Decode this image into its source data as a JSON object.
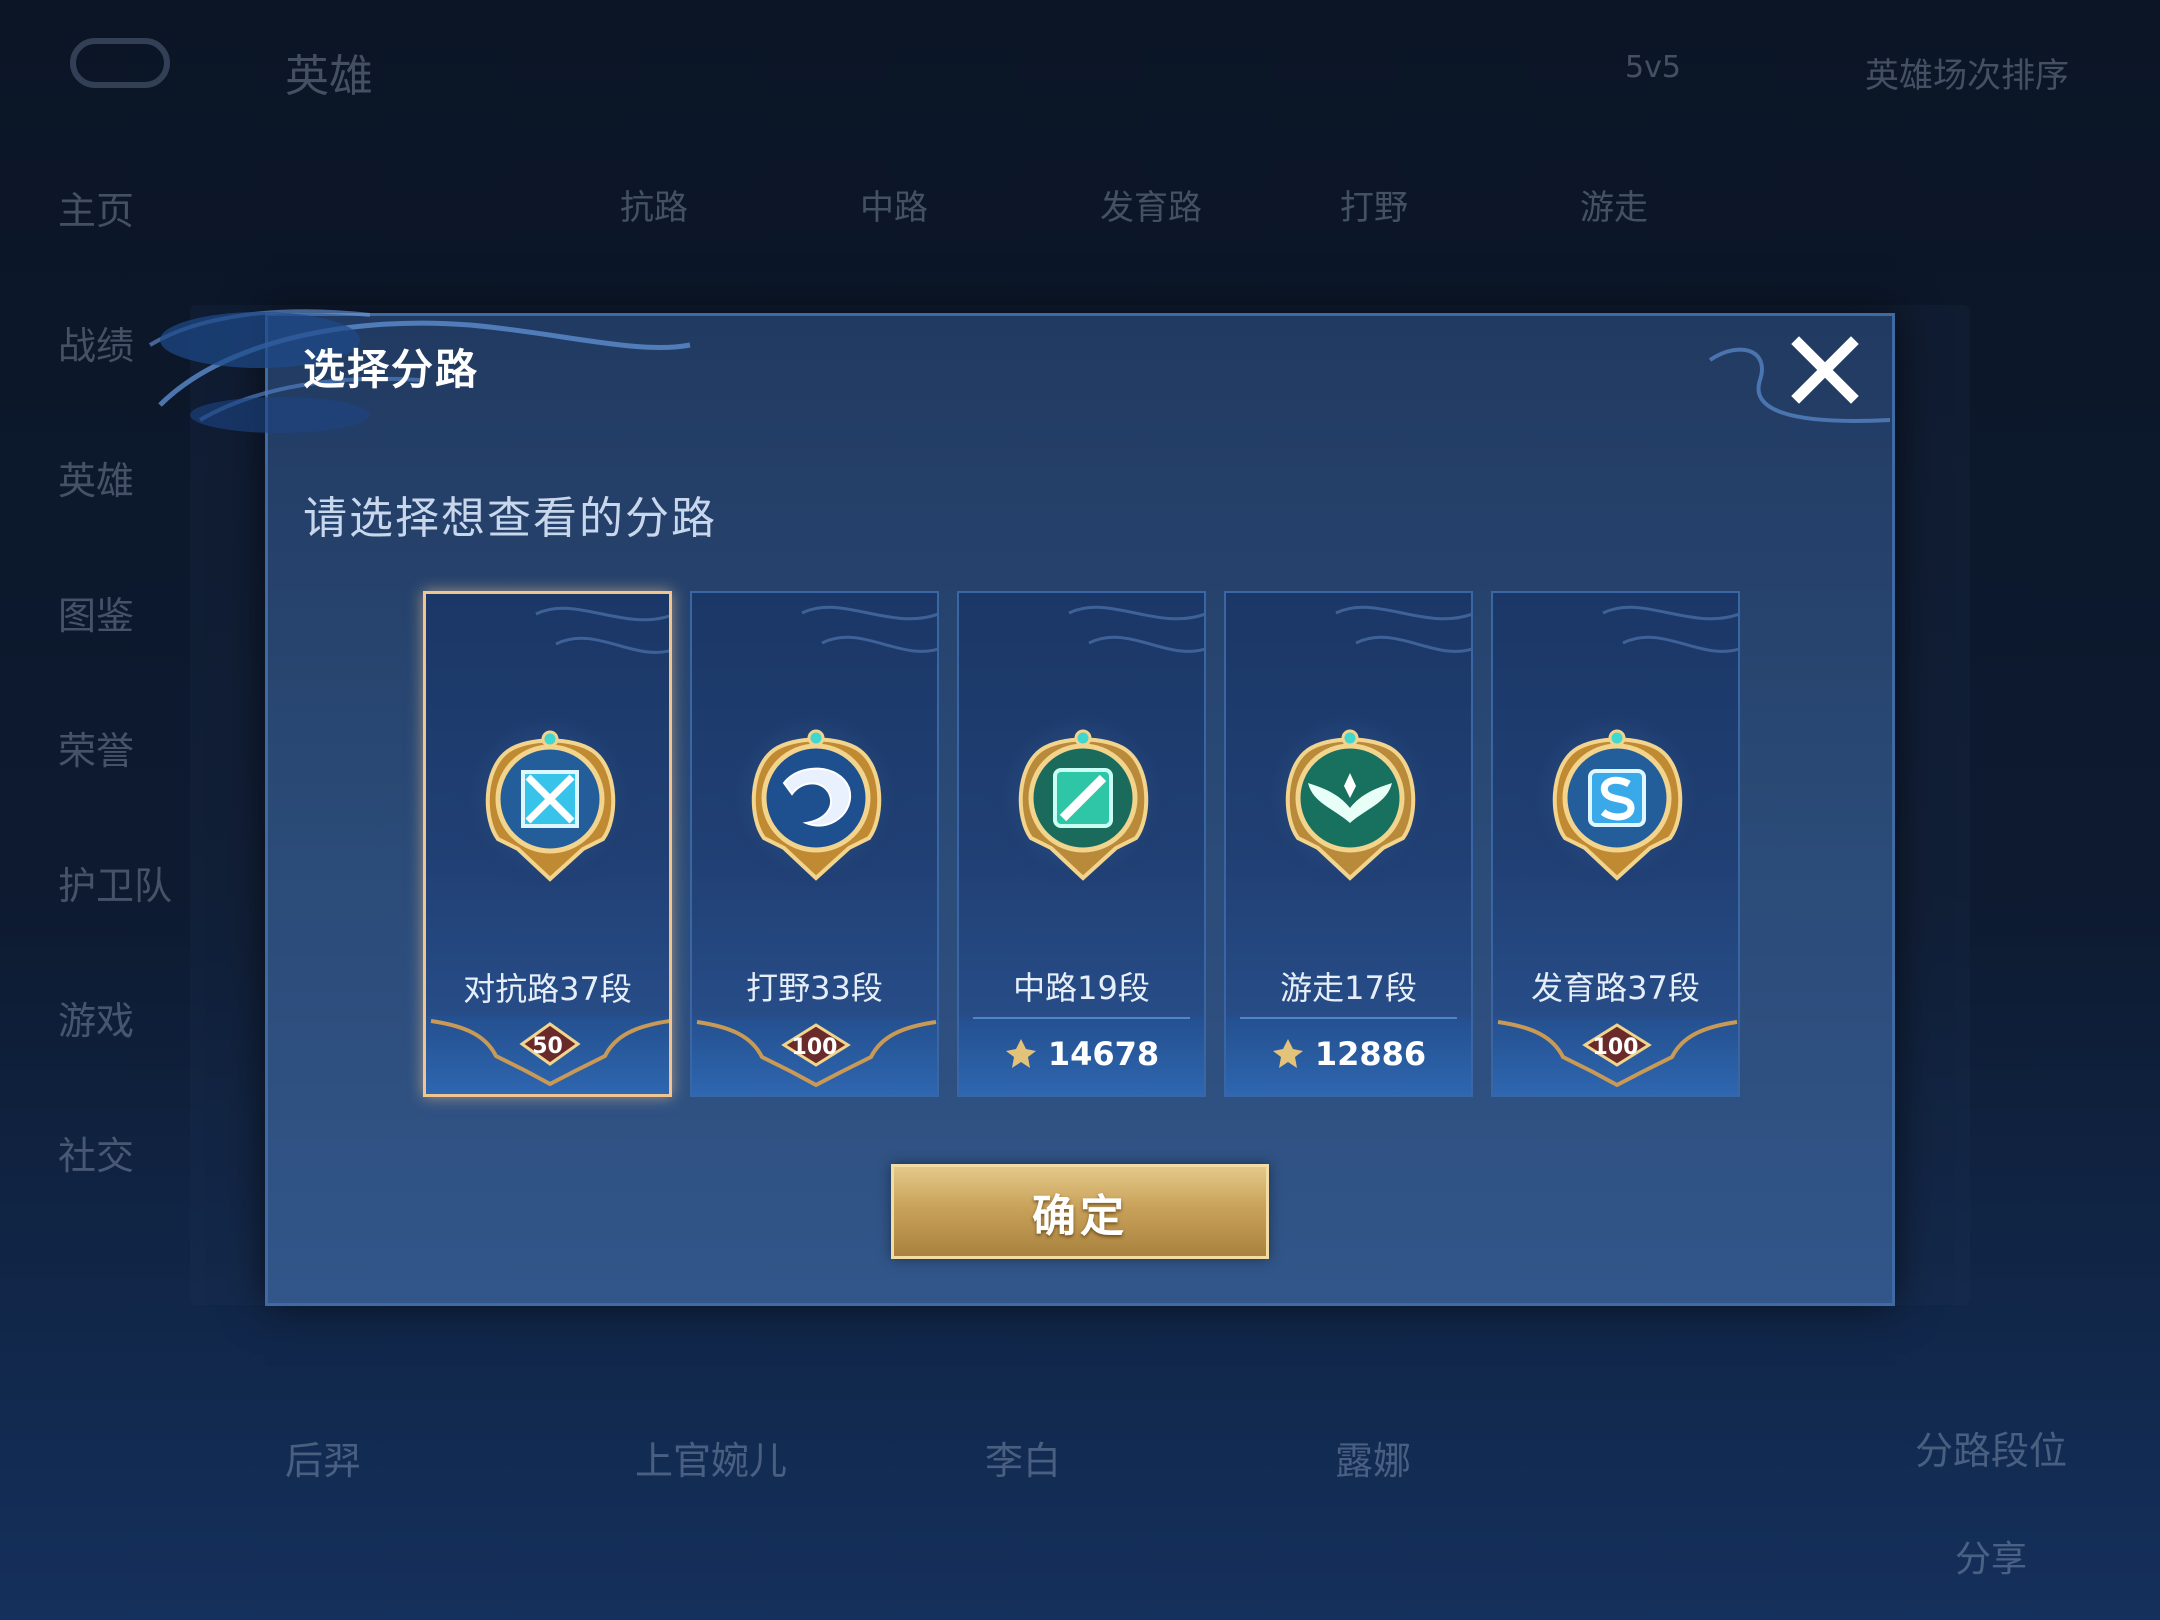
{
  "background": {
    "title": "英雄",
    "mode_filter": "5v5",
    "sort_filter": "英雄场次排序",
    "nav": [
      "主页",
      "战绩",
      "英雄",
      "图鉴",
      "荣誉",
      "护卫队",
      "游戏",
      "社交"
    ],
    "tabs": [
      "抗路",
      "中路",
      "发育路",
      "打野",
      "游走"
    ],
    "cards": [
      "后羿",
      "上官婉儿",
      "李白",
      "露娜"
    ],
    "right_label": "分路段位",
    "share_label": "分享"
  },
  "modal": {
    "title": "选择分路",
    "subtitle": "请选择想查看的分路",
    "confirm_label": "确定",
    "lanes": [
      {
        "label": "对抗路37段",
        "badge": "50",
        "footer": "badge",
        "icon": "clash-lane-sword-icon",
        "selected": true
      },
      {
        "label": "打野33段",
        "badge": "100",
        "footer": "badge",
        "icon": "jungle-dragon-icon",
        "selected": false
      },
      {
        "label": "中路19段",
        "score": "14678",
        "footer": "score",
        "icon": "mid-lane-icon",
        "selected": false
      },
      {
        "label": "游走17段",
        "score": "12886",
        "footer": "score",
        "icon": "roam-wings-icon",
        "selected": false
      },
      {
        "label": "发育路37段",
        "badge": "100",
        "footer": "badge",
        "icon": "farm-lane-icon",
        "selected": false
      }
    ]
  },
  "colors": {
    "accent_gold": "#e4c98a",
    "selected_border": "#f0c590",
    "panel_blue": "#2b4b78"
  }
}
